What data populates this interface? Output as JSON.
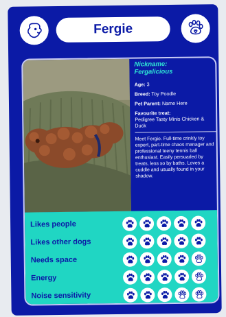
{
  "header": {
    "name": "Fergie",
    "left_icon": "dog-head-icon",
    "right_icon": "paw-heart-icon"
  },
  "profile": {
    "nickname_label": "Nickname:",
    "nickname": "Fergalicious",
    "age_label": "Age:",
    "age": "3",
    "breed_label": "Breed:",
    "breed": "Toy Poodle",
    "parent_label": "Pet Parent:",
    "parent": "Name Here",
    "treat_label": "Favourite treat:",
    "treat": "Pedigree Tasty Minis Chicken & Duck",
    "bio": "Meet Fergie. Full-time crinkly toy expert, part-time chaos manager and professional teeny tennis ball enthusiast. Easily persuaded by treats, less so by baths. Loves a cuddle and usually found in your shadow."
  },
  "traits": [
    {
      "label": "Likes people",
      "rating": 5,
      "max": 5
    },
    {
      "label": "Likes other dogs",
      "rating": 5,
      "max": 5
    },
    {
      "label": "Needs space",
      "rating": 4,
      "max": 5
    },
    {
      "label": "Energy",
      "rating": 4,
      "max": 5
    },
    {
      "label": "Noise sensitivity",
      "rating": 3,
      "max": 5
    }
  ],
  "colors": {
    "card": "#0b1aa6",
    "teal": "#20d6c3",
    "nickname": "#2ee5d4",
    "paw_filled": "#0b1aa6",
    "paw_outline": "#0b1aa6"
  }
}
